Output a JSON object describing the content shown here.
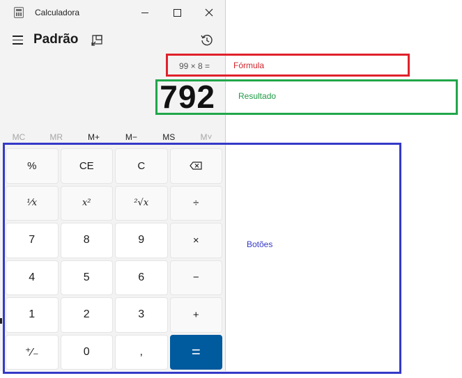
{
  "window": {
    "title": "Calculadora",
    "mode_title": "Padrão"
  },
  "display": {
    "formula": "99 × 8 =",
    "result": "792"
  },
  "memory": [
    {
      "label": "MC",
      "enabled": false
    },
    {
      "label": "MR",
      "enabled": false
    },
    {
      "label": "M+",
      "enabled": true
    },
    {
      "label": "M−",
      "enabled": true
    },
    {
      "label": "MS",
      "enabled": true
    },
    {
      "label": "M˅",
      "enabled": false
    }
  ],
  "keys": {
    "percent": "%",
    "ce": "CE",
    "c": "C",
    "reciprocal": "¹⁄𝑥",
    "square": "x²",
    "sqrt": "²√x",
    "divide": "÷",
    "n7": "7",
    "n8": "8",
    "n9": "9",
    "multiply": "×",
    "n4": "4",
    "n5": "5",
    "n6": "6",
    "minus": "−",
    "n1": "1",
    "n2": "2",
    "n3": "3",
    "plus": "+",
    "negate": "⁺⁄₋",
    "n0": "0",
    "decimal": ",",
    "equals": "="
  },
  "annotations": {
    "formula_label": "Fórmula",
    "result_label": "Resultado",
    "buttons_label": "Botões",
    "colors": {
      "formula": "#e0212b",
      "result": "#21a64a",
      "buttons": "#3539c7",
      "equals_key": "#005a9e"
    }
  }
}
